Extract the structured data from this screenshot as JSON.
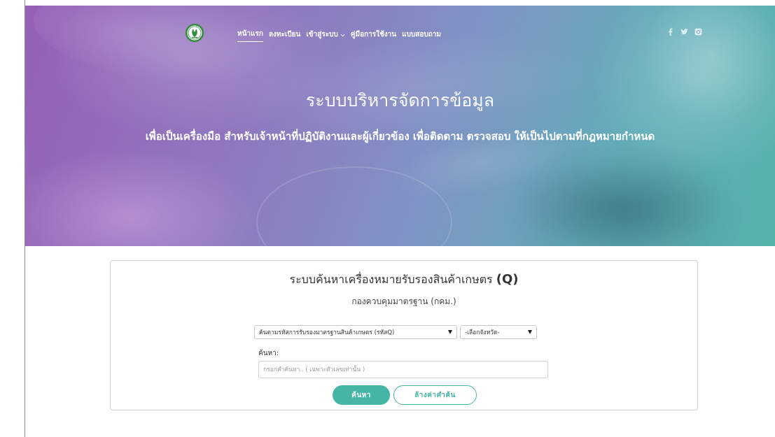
{
  "nav": {
    "items": [
      {
        "label": "หน้าแรก",
        "active": true
      },
      {
        "label": "ลงทะเบียน"
      },
      {
        "label": "เข้าสู่ระบบ",
        "dropdown": true
      },
      {
        "label": "คู่มือการใช้งาน"
      },
      {
        "label": "แบบสอบถาม"
      }
    ],
    "logo_icon": "department-emblem-icon",
    "social_icons": [
      "facebook-icon",
      "twitter-icon",
      "instagram-icon"
    ]
  },
  "hero": {
    "title": "ระบบบริหารจัดการข้อมูล",
    "subtitle": "เพื่อเป็นเครื่องมือ สำหรับเจ้าหน้าที่ปฏิบัติงานและผู้เกี่ยวข้อง เพื่อติดตาม ตรวจสอบ ให้เป็นไปตามที่กฎหมายกำหนด"
  },
  "search_card": {
    "title": "ระบบค้นหาเครื่องหมายรับรองสินค้าเกษตร",
    "title_badge": "(Q)",
    "subtitle": "กองควบคุมมาตรฐาน (กคม.)",
    "search_type_select": {
      "selected": "ค้นตามรหัสการรับรองมาตรฐานสินค้าเกษตร (รหัสQ)"
    },
    "province_select": {
      "selected": "-เลือกจังหวัด-"
    },
    "search_label": "ค้นหา:",
    "search_input": {
      "value": "",
      "placeholder": "กรอกคำค้นหา.. ( เฉพาะตัวเลขเท่านั้น )"
    },
    "search_button": "ค้นหา",
    "clear_button": "ล้างค่าคำค้น"
  },
  "colors": {
    "accent": "#45b5a5",
    "logo_green": "#2f8a3a",
    "hero_start": "#9560b6",
    "hero_mid": "#7f93c4",
    "hero_end": "#55b3a9"
  }
}
